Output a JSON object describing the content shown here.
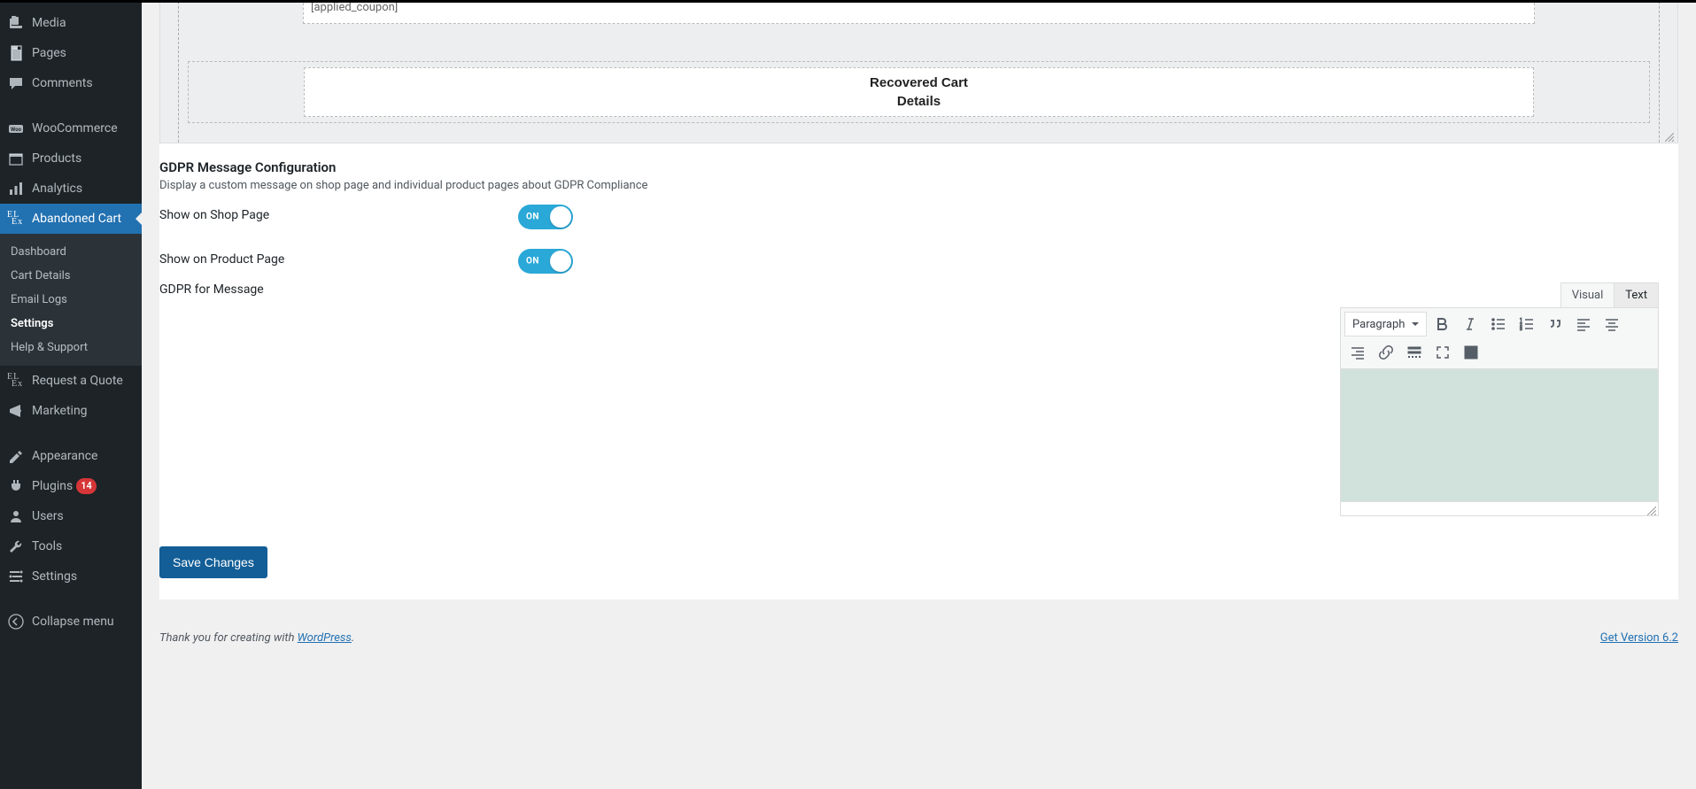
{
  "sidebar": {
    "items": [
      {
        "label": "Media"
      },
      {
        "label": "Pages"
      },
      {
        "label": "Comments"
      },
      {
        "label": "WooCommerce"
      },
      {
        "label": "Products"
      },
      {
        "label": "Analytics"
      },
      {
        "label": "Abandoned Cart"
      },
      {
        "label": "Request a Quote"
      },
      {
        "label": "Marketing"
      },
      {
        "label": "Appearance"
      },
      {
        "label": "Plugins",
        "badge": "14"
      },
      {
        "label": "Users"
      },
      {
        "label": "Tools"
      },
      {
        "label": "Settings"
      },
      {
        "label": "Collapse menu"
      }
    ],
    "submenu": {
      "items": [
        {
          "label": "Dashboard"
        },
        {
          "label": "Cart Details"
        },
        {
          "label": "Email Logs"
        },
        {
          "label": "Settings"
        },
        {
          "label": "Help & Support"
        }
      ]
    }
  },
  "template_preview": {
    "shortcode_text": "[applied_coupon]",
    "recovered_heading_1": "Recovered Cart",
    "recovered_heading_2": "Details"
  },
  "gdpr": {
    "heading": "GDPR Message Configuration",
    "description": "Display a custom message on shop page and individual product pages about GDPR Compliance",
    "shop_label": "Show on Shop Page",
    "product_label": "Show on Product Page",
    "message_label": "GDPR for Message",
    "toggle_on_text": "ON"
  },
  "editor": {
    "tab_visual": "Visual",
    "tab_text": "Text",
    "format_label": "Paragraph"
  },
  "buttons": {
    "save": "Save Changes"
  },
  "footer": {
    "prefix": "Thank you for creating with ",
    "wp_label": "WordPress",
    "suffix": ".",
    "version_link": "Get Version 6.2"
  }
}
